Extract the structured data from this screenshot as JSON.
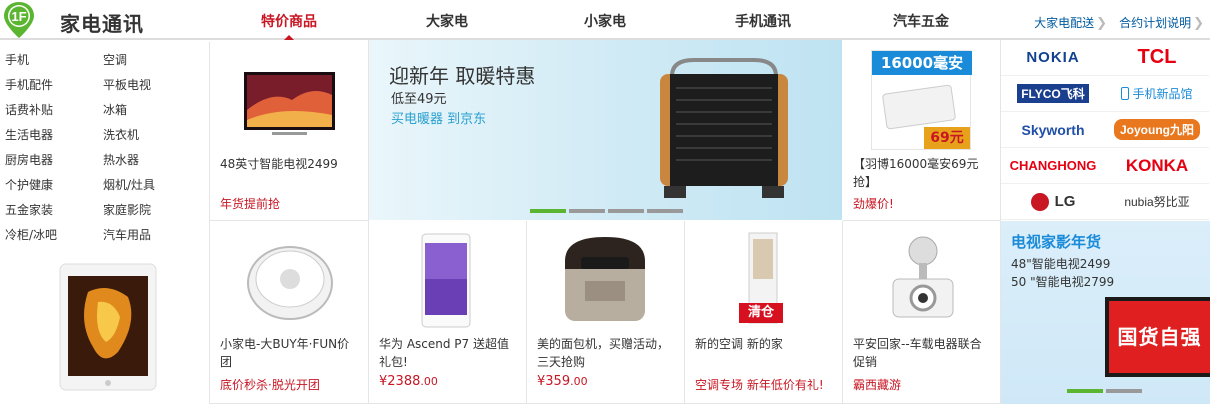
{
  "header": {
    "badge": "1F",
    "title": "家电通讯",
    "tabs": [
      "特价商品",
      "大家电",
      "小家电",
      "手机通讯",
      "汽车五金"
    ],
    "links": [
      "大家电配送",
      "合约计划说明"
    ]
  },
  "categories": [
    "手机",
    "空调",
    "手机配件",
    "平板电视",
    "话费补贴",
    "冰箱",
    "生活电器",
    "洗衣机",
    "厨房电器",
    "热水器",
    "个护健康",
    "烟机/灶具",
    "五金家装",
    "家庭影院",
    "冷柜/冰吧",
    "汽车用品"
  ],
  "products": {
    "tv": {
      "desc": "48英寸智能电视2499",
      "promo": "年货提前抢"
    },
    "powerbank": {
      "desc": "【羽博16000毫安69元抢】",
      "promo": "劲爆价!",
      "img_top": "16000毫安",
      "img_price": "69元"
    },
    "robot": {
      "desc": "小家电-大BUY年·FUN价团",
      "promo": "底价秒杀·脱光开团"
    },
    "huawei": {
      "desc": "华为 Ascend P7 送超值礼包!",
      "price": "¥2388",
      "price_dec": ".00"
    },
    "breadmaker": {
      "desc": "美的面包机，买赠活动，三天抢购",
      "price": "¥359",
      "price_dec": ".00"
    },
    "aircon": {
      "desc": "新的空调 新的家",
      "promo": "空调专场 新年低价有礼!",
      "tag": "清仓"
    },
    "dashcam": {
      "desc": "平安回家--车载电器联合促销",
      "promo": "霸西藏游"
    }
  },
  "banner": {
    "title": "迎新年 取暖特惠",
    "sub": "低至49元",
    "cta": "买电暖器 到京东",
    "dots": 4,
    "active_dot": 0
  },
  "brands": [
    {
      "name": "NOKIA",
      "color": "#124191"
    },
    {
      "name": "TCL",
      "color": "#e60012"
    },
    {
      "name": "FLYCO飞科",
      "color": "#ffffff",
      "bg": "#1b3f8f"
    },
    {
      "name": "手机新品馆",
      "color": "#1a8bd8"
    },
    {
      "name": "Skyworth",
      "color": "#1f4fa8"
    },
    {
      "name": "Joyoung九阳",
      "color": "#ffffff",
      "bg": "#e8771d"
    },
    {
      "name": "CHANGHONG",
      "color": "#e60012"
    },
    {
      "name": "KONKA",
      "color": "#e60012"
    },
    {
      "name": "LG",
      "color": "#333333"
    },
    {
      "name": "nubia努比亚",
      "color": "#333333"
    }
  ],
  "promo_tv": {
    "title": "电视家影年货",
    "lines": [
      "48\"智能电视2499",
      "50  \"智能电视2799"
    ],
    "badge": "国货自强"
  },
  "colors": {
    "accent": "#c81623",
    "link": "#005aa0",
    "green": "#5cb531"
  }
}
